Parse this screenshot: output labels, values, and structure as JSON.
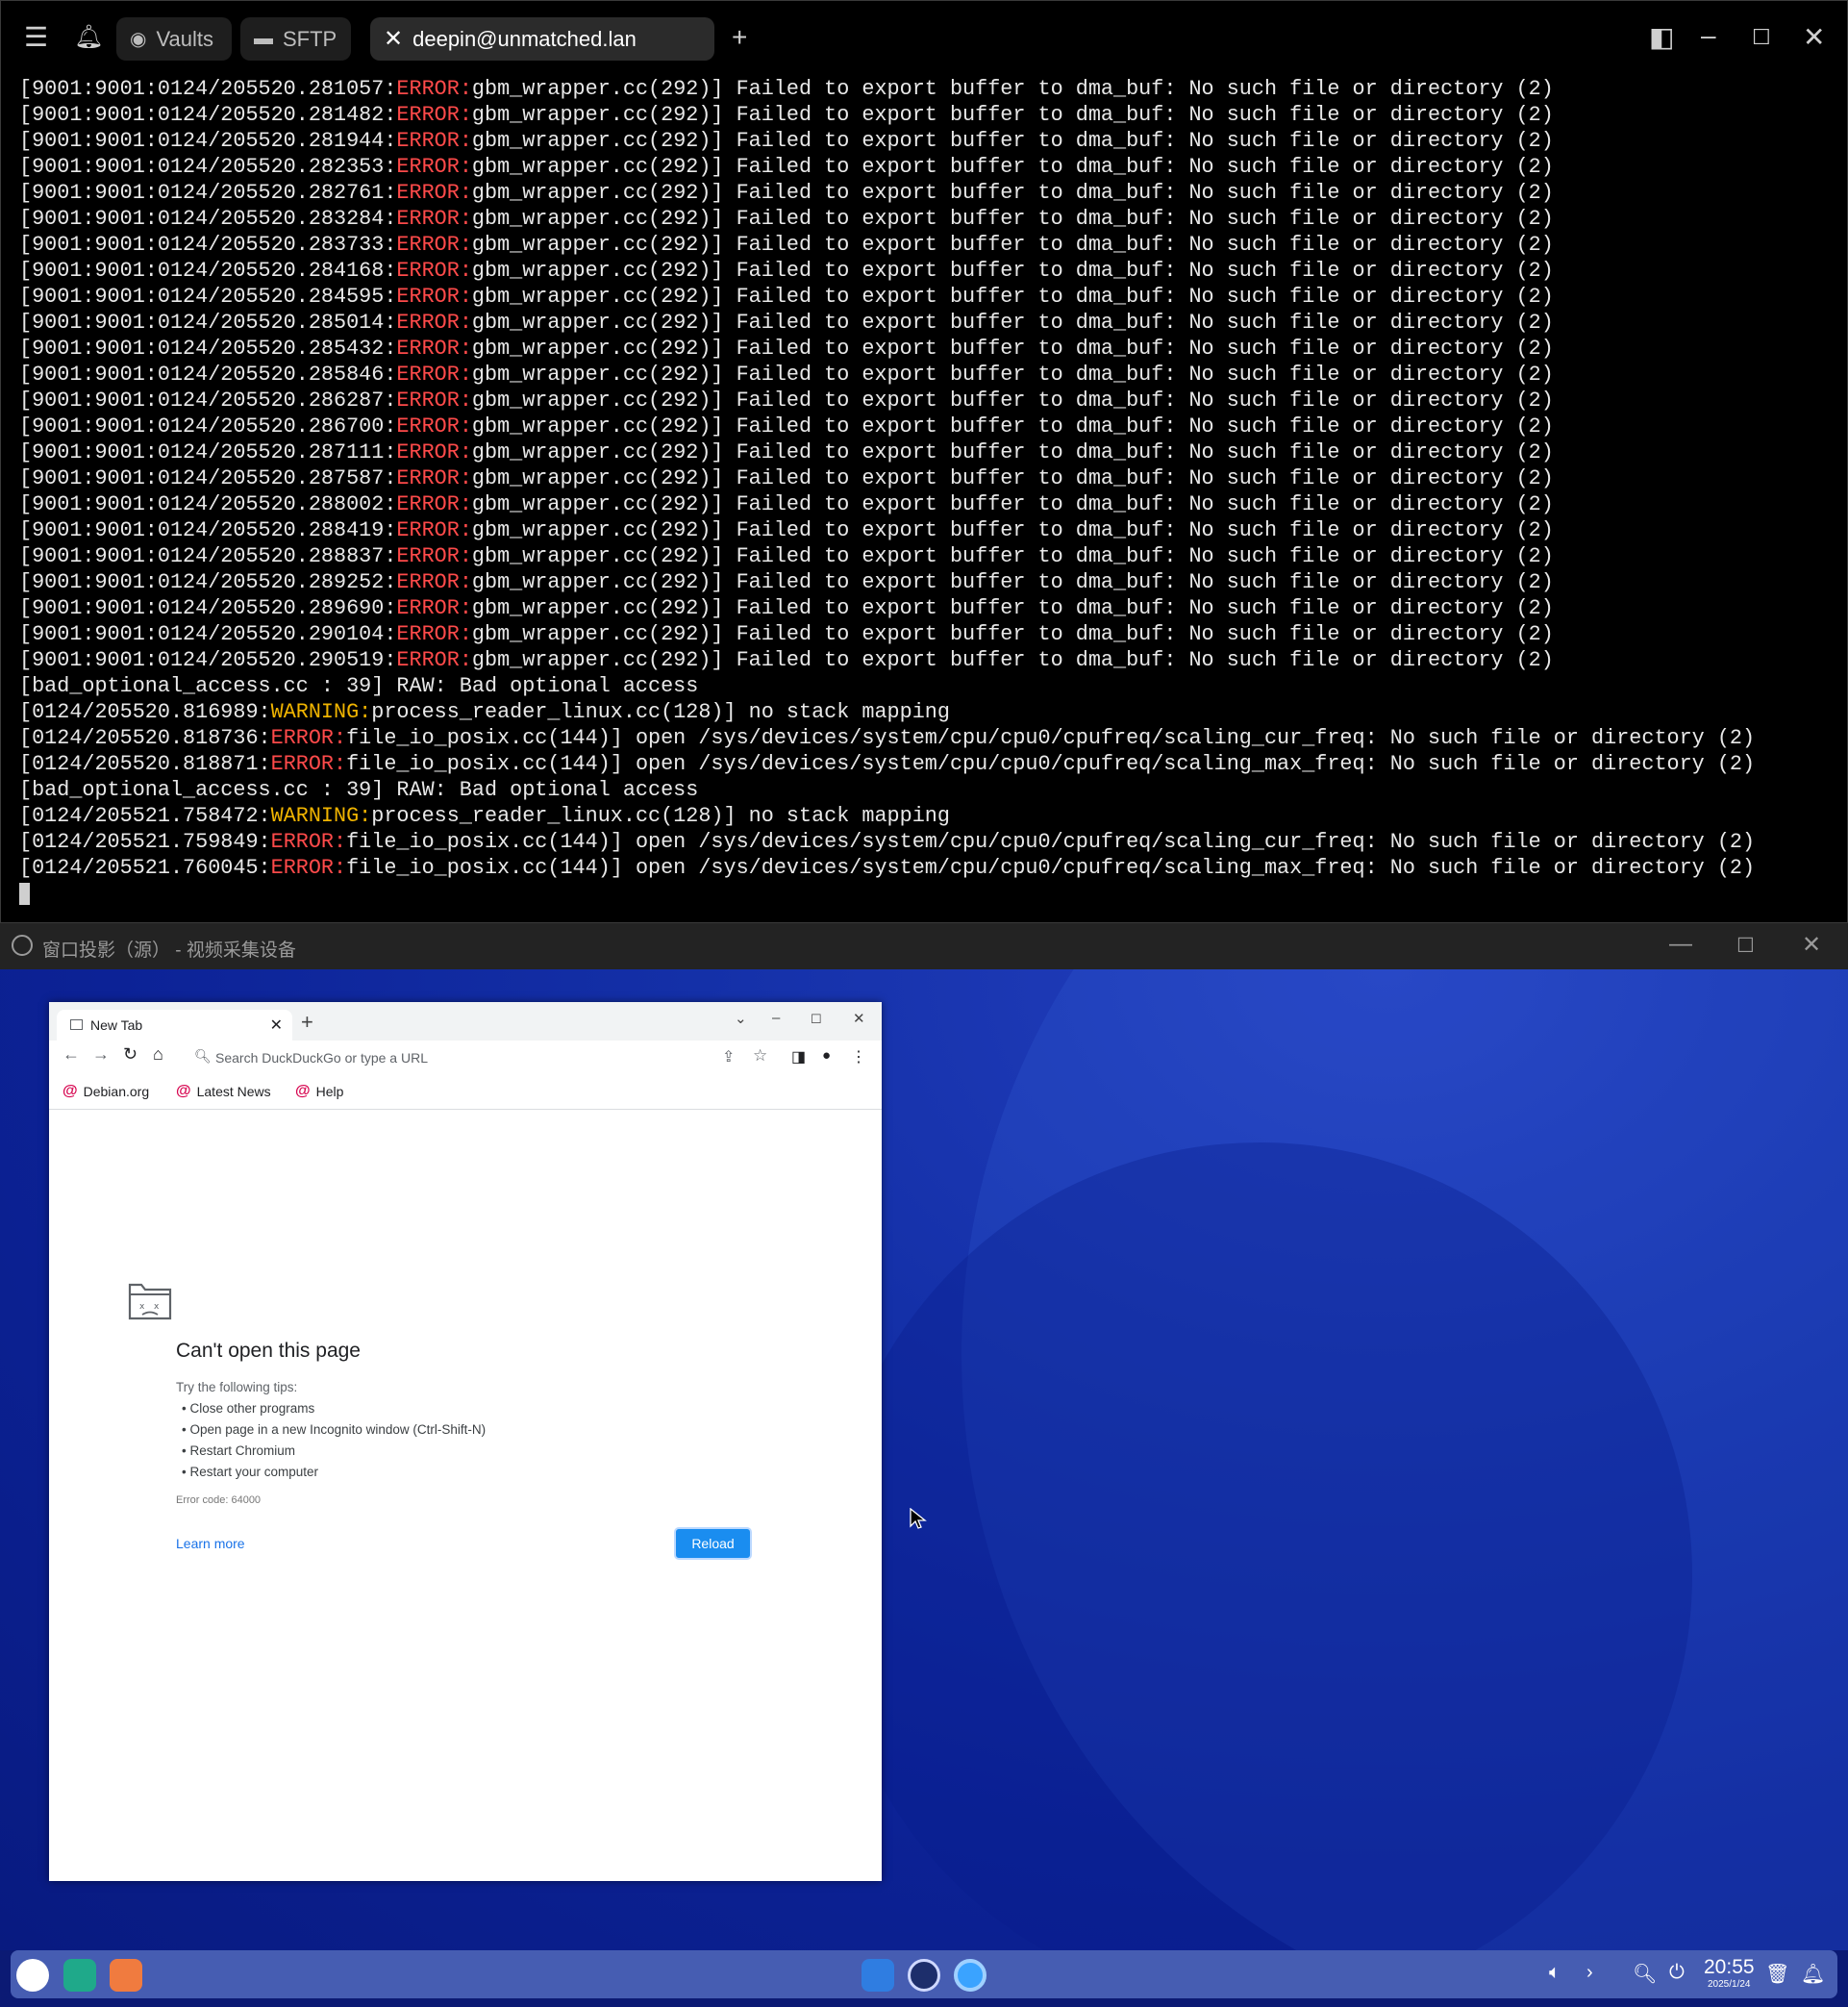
{
  "terminal": {
    "tabs": [
      {
        "label": "Vaults"
      },
      {
        "label": "SFTP"
      },
      {
        "label": "deepin@unmatched.lan"
      }
    ],
    "lines": [
      [
        "[9001:9001:0124/205520.281057:",
        "ERROR:",
        "gbm_wrapper.cc(292)] Failed to export buffer to dma_buf: No such file or directory (2)"
      ],
      [
        "[9001:9001:0124/205520.281482:",
        "ERROR:",
        "gbm_wrapper.cc(292)] Failed to export buffer to dma_buf: No such file or directory (2)"
      ],
      [
        "[9001:9001:0124/205520.281944:",
        "ERROR:",
        "gbm_wrapper.cc(292)] Failed to export buffer to dma_buf: No such file or directory (2)"
      ],
      [
        "[9001:9001:0124/205520.282353:",
        "ERROR:",
        "gbm_wrapper.cc(292)] Failed to export buffer to dma_buf: No such file or directory (2)"
      ],
      [
        "[9001:9001:0124/205520.282761:",
        "ERROR:",
        "gbm_wrapper.cc(292)] Failed to export buffer to dma_buf: No such file or directory (2)"
      ],
      [
        "[9001:9001:0124/205520.283284:",
        "ERROR:",
        "gbm_wrapper.cc(292)] Failed to export buffer to dma_buf: No such file or directory (2)"
      ],
      [
        "[9001:9001:0124/205520.283733:",
        "ERROR:",
        "gbm_wrapper.cc(292)] Failed to export buffer to dma_buf: No such file or directory (2)"
      ],
      [
        "[9001:9001:0124/205520.284168:",
        "ERROR:",
        "gbm_wrapper.cc(292)] Failed to export buffer to dma_buf: No such file or directory (2)"
      ],
      [
        "[9001:9001:0124/205520.284595:",
        "ERROR:",
        "gbm_wrapper.cc(292)] Failed to export buffer to dma_buf: No such file or directory (2)"
      ],
      [
        "[9001:9001:0124/205520.285014:",
        "ERROR:",
        "gbm_wrapper.cc(292)] Failed to export buffer to dma_buf: No such file or directory (2)"
      ],
      [
        "[9001:9001:0124/205520.285432:",
        "ERROR:",
        "gbm_wrapper.cc(292)] Failed to export buffer to dma_buf: No such file or directory (2)"
      ],
      [
        "[9001:9001:0124/205520.285846:",
        "ERROR:",
        "gbm_wrapper.cc(292)] Failed to export buffer to dma_buf: No such file or directory (2)"
      ],
      [
        "[9001:9001:0124/205520.286287:",
        "ERROR:",
        "gbm_wrapper.cc(292)] Failed to export buffer to dma_buf: No such file or directory (2)"
      ],
      [
        "[9001:9001:0124/205520.286700:",
        "ERROR:",
        "gbm_wrapper.cc(292)] Failed to export buffer to dma_buf: No such file or directory (2)"
      ],
      [
        "[9001:9001:0124/205520.287111:",
        "ERROR:",
        "gbm_wrapper.cc(292)] Failed to export buffer to dma_buf: No such file or directory (2)"
      ],
      [
        "[9001:9001:0124/205520.287587:",
        "ERROR:",
        "gbm_wrapper.cc(292)] Failed to export buffer to dma_buf: No such file or directory (2)"
      ],
      [
        "[9001:9001:0124/205520.288002:",
        "ERROR:",
        "gbm_wrapper.cc(292)] Failed to export buffer to dma_buf: No such file or directory (2)"
      ],
      [
        "[9001:9001:0124/205520.288419:",
        "ERROR:",
        "gbm_wrapper.cc(292)] Failed to export buffer to dma_buf: No such file or directory (2)"
      ],
      [
        "[9001:9001:0124/205520.288837:",
        "ERROR:",
        "gbm_wrapper.cc(292)] Failed to export buffer to dma_buf: No such file or directory (2)"
      ],
      [
        "[9001:9001:0124/205520.289252:",
        "ERROR:",
        "gbm_wrapper.cc(292)] Failed to export buffer to dma_buf: No such file or directory (2)"
      ],
      [
        "[9001:9001:0124/205520.289690:",
        "ERROR:",
        "gbm_wrapper.cc(292)] Failed to export buffer to dma_buf: No such file or directory (2)"
      ],
      [
        "[9001:9001:0124/205520.290104:",
        "ERROR:",
        "gbm_wrapper.cc(292)] Failed to export buffer to dma_buf: No such file or directory (2)"
      ],
      [
        "[9001:9001:0124/205520.290519:",
        "ERROR:",
        "gbm_wrapper.cc(292)] Failed to export buffer to dma_buf: No such file or directory (2)"
      ],
      [
        "[bad_optional_access.cc : 39] RAW: Bad optional access",
        "",
        ""
      ],
      [
        "[0124/205520.816989:",
        "WARNING:",
        "process_reader_linux.cc(128)] no stack mapping"
      ],
      [
        "[0124/205520.818736:",
        "ERROR:",
        "file_io_posix.cc(144)] open /sys/devices/system/cpu/cpu0/cpufreq/scaling_cur_freq: No such file or directory (2)"
      ],
      [
        "[0124/205520.818871:",
        "ERROR:",
        "file_io_posix.cc(144)] open /sys/devices/system/cpu/cpu0/cpufreq/scaling_max_freq: No such file or directory (2)"
      ],
      [
        "[bad_optional_access.cc : 39] RAW: Bad optional access",
        "",
        ""
      ],
      [
        "[0124/205521.758472:",
        "WARNING:",
        "process_reader_linux.cc(128)] no stack mapping"
      ],
      [
        "[0124/205521.759849:",
        "ERROR:",
        "file_io_posix.cc(144)] open /sys/devices/system/cpu/cpu0/cpufreq/scaling_cur_freq: No such file or directory (2)"
      ],
      [
        "[0124/205521.760045:",
        "ERROR:",
        "file_io_posix.cc(144)] open /sys/devices/system/cpu/cpu0/cpufreq/scaling_max_freq: No such file or directory (2)"
      ]
    ]
  },
  "projection": {
    "title": "窗口投影（源） - 视频采集设备"
  },
  "browser": {
    "tab_title": "New Tab",
    "omnibox_placeholder": "Search DuckDuckGo or type a URL",
    "bookmarks": [
      "Debian.org",
      "Latest News",
      "Help"
    ],
    "error": {
      "heading": "Can't open this page",
      "tips_intro": "Try the following tips:",
      "tips": [
        "• Close other programs",
        "• Open page in a new Incognito window (Ctrl-Shift-N)",
        "• Restart Chromium",
        "• Restart your computer"
      ],
      "code": "Error code: 64000",
      "learn_more": "Learn more",
      "reload": "Reload"
    }
  },
  "taskbar": {
    "time": "20:55",
    "date": "2025/1/24"
  },
  "colors": {
    "error": "#ff4a4a",
    "warning": "#f0b400",
    "desktop": "#0c2296",
    "reload_button": "#1a8df0"
  }
}
